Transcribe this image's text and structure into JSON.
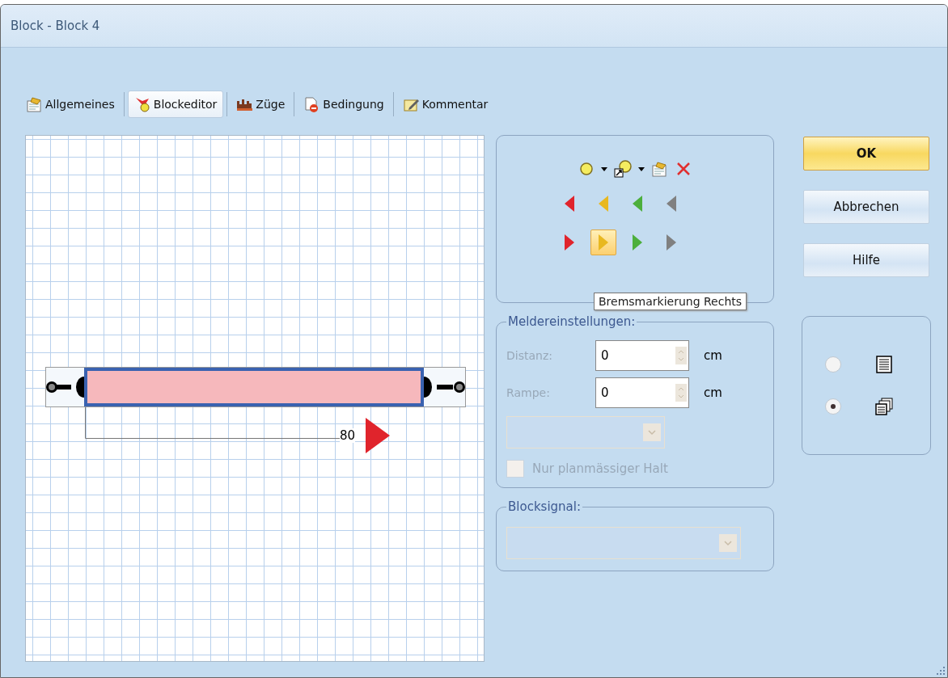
{
  "window": {
    "title": "Block - Block 4"
  },
  "tabs": [
    {
      "label": "Allgemeines",
      "selected": false
    },
    {
      "label": "Blockeditor",
      "selected": true
    },
    {
      "label": "Züge",
      "selected": false
    },
    {
      "label": "Bedingung",
      "selected": false
    },
    {
      "label": "Kommentar",
      "selected": false
    }
  ],
  "editor": {
    "speed_marker": {
      "label": "80",
      "color": "#e0242c"
    }
  },
  "toolbar": {
    "marker_rows": [
      {
        "kind": "left",
        "items": [
          {
            "color": "#e0242c",
            "selected": false
          },
          {
            "color": "#e8b820",
            "selected": false
          },
          {
            "color": "#4caf3c",
            "selected": false
          },
          {
            "color": "#808080",
            "selected": false
          }
        ]
      },
      {
        "kind": "right",
        "items": [
          {
            "color": "#e0242c",
            "selected": false
          },
          {
            "color": "#e8b820",
            "selected": true
          },
          {
            "color": "#4caf3c",
            "selected": false
          },
          {
            "color": "#808080",
            "selected": false
          }
        ]
      }
    ],
    "tooltip": "Bremsmarkierung Rechts"
  },
  "melder": {
    "legend": "Meldereinstellungen:",
    "fields": [
      {
        "label": "Distanz:",
        "value": "0",
        "unit": "cm",
        "disabled": true
      },
      {
        "label": "Rampe:",
        "value": "0",
        "unit": "cm",
        "disabled": true
      }
    ],
    "checkbox": {
      "label": "Nur planmässiger Halt",
      "checked": false,
      "disabled": true
    }
  },
  "blocksignal": {
    "legend": "Blocksignal:"
  },
  "buttons": [
    {
      "label": "OK",
      "kind": "default"
    },
    {
      "label": "Abbrechen",
      "kind": "normal"
    },
    {
      "label": "Hilfe",
      "kind": "normal"
    }
  ],
  "view_options": [
    {
      "selected": false
    },
    {
      "selected": true
    }
  ]
}
